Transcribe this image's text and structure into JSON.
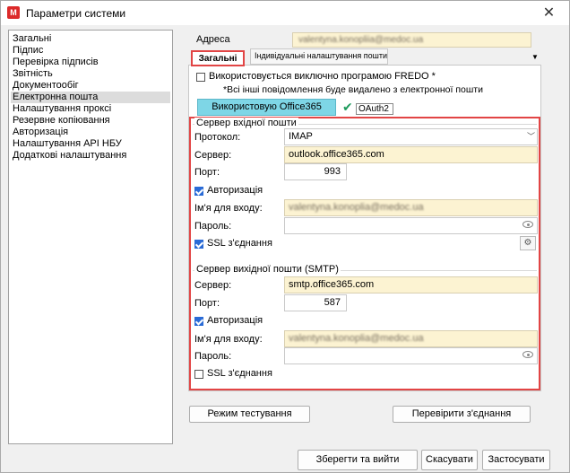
{
  "window": {
    "title": "Параметри системи",
    "app_icon": "M",
    "close_glyph": "✕"
  },
  "nav": {
    "items": [
      "Загальні",
      "Підпис",
      "Перевірка підписів",
      "Звітність",
      "Документообіг",
      "Електронна пошта",
      "Налаштування проксі",
      "Резервне копіювання",
      "Авторизація",
      "Налаштування API НБУ",
      "Додаткові налаштування"
    ],
    "selected_index": 5
  },
  "email": {
    "address_label": "Адреса",
    "address_value": "valentyna.konopliia@medoc.ua",
    "tabs": [
      "Загальні",
      "Індивідуальні налаштування пошти"
    ],
    "fredo_only_label": "Використовується виключно програмою FREDO *",
    "fredo_note": "*Всі інші повідомлення буде видалено з електронної пошти",
    "use_o365_button": "Використовую Office365",
    "oauth_label": "OAuth2",
    "incoming": {
      "group_title": "Сервер вхідної пошти",
      "protocol_label": "Протокол:",
      "protocol_value": "IMAP",
      "server_label": "Сервер:",
      "server_value": "outlook.office365.com",
      "port_label": "Порт:",
      "port_value": "993",
      "auth_label": "Авторизація",
      "login_label": "Ім'я для входу:",
      "login_value": "valentyna.konoplia@medoc.ua",
      "password_label": "Пароль:",
      "ssl_label": "SSL з'єднання"
    },
    "outgoing": {
      "group_title": "Сервер вихідної пошти (SMTP)",
      "server_label": "Сервер:",
      "server_value": "smtp.office365.com",
      "port_label": "Порт:",
      "port_value": "587",
      "auth_label": "Авторизація",
      "login_label": "Ім'я для входу:",
      "login_value": "valentyna.konoplia@medoc.ua",
      "password_label": "Пароль:",
      "ssl_label": "SSL з'єднання"
    },
    "test_mode_button": "Режим тестування",
    "check_connection_button": "Перевірити з'єднання"
  },
  "footer": {
    "save_exit": "Зберегти та вийти",
    "cancel": "Скасувати",
    "apply": "Застосувати"
  }
}
